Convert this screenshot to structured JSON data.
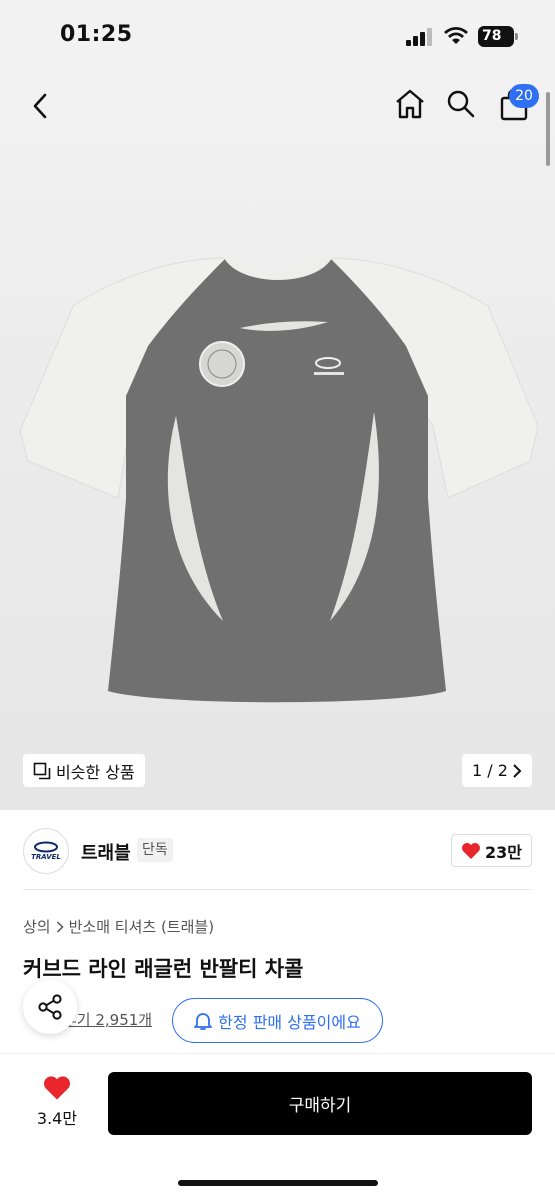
{
  "status_bar": {
    "time": "01:25",
    "battery": "78"
  },
  "header": {
    "back_icon": "chevron-left-icon",
    "home_icon": "home-icon",
    "search_icon": "search-icon",
    "cart_icon": "shopping-bag-icon",
    "cart_count": "20",
    "badge_color": "#2f6ff2"
  },
  "gallery": {
    "similar_label": "비슷한 상품",
    "page_indicator": "1 / 2",
    "shirt_body_color": "#707070",
    "shirt_sleeve_color": "#f0f1ef"
  },
  "brand": {
    "logo_text": "TRAVEL",
    "name": "트래블",
    "tag": "단독",
    "like_count": "23만"
  },
  "product": {
    "breadcrumb": [
      "상의",
      "반소매 티셔츠 (트래블)"
    ],
    "title": "커브드 라인 래글런 반팔티 차콜",
    "review_label": "후기 2,951개"
  },
  "toast": {
    "text": "한정 판매 상품이에요"
  },
  "bottom": {
    "wish_count": "3.4만",
    "buy_label": "구매하기",
    "heart_color": "#e8262b"
  }
}
